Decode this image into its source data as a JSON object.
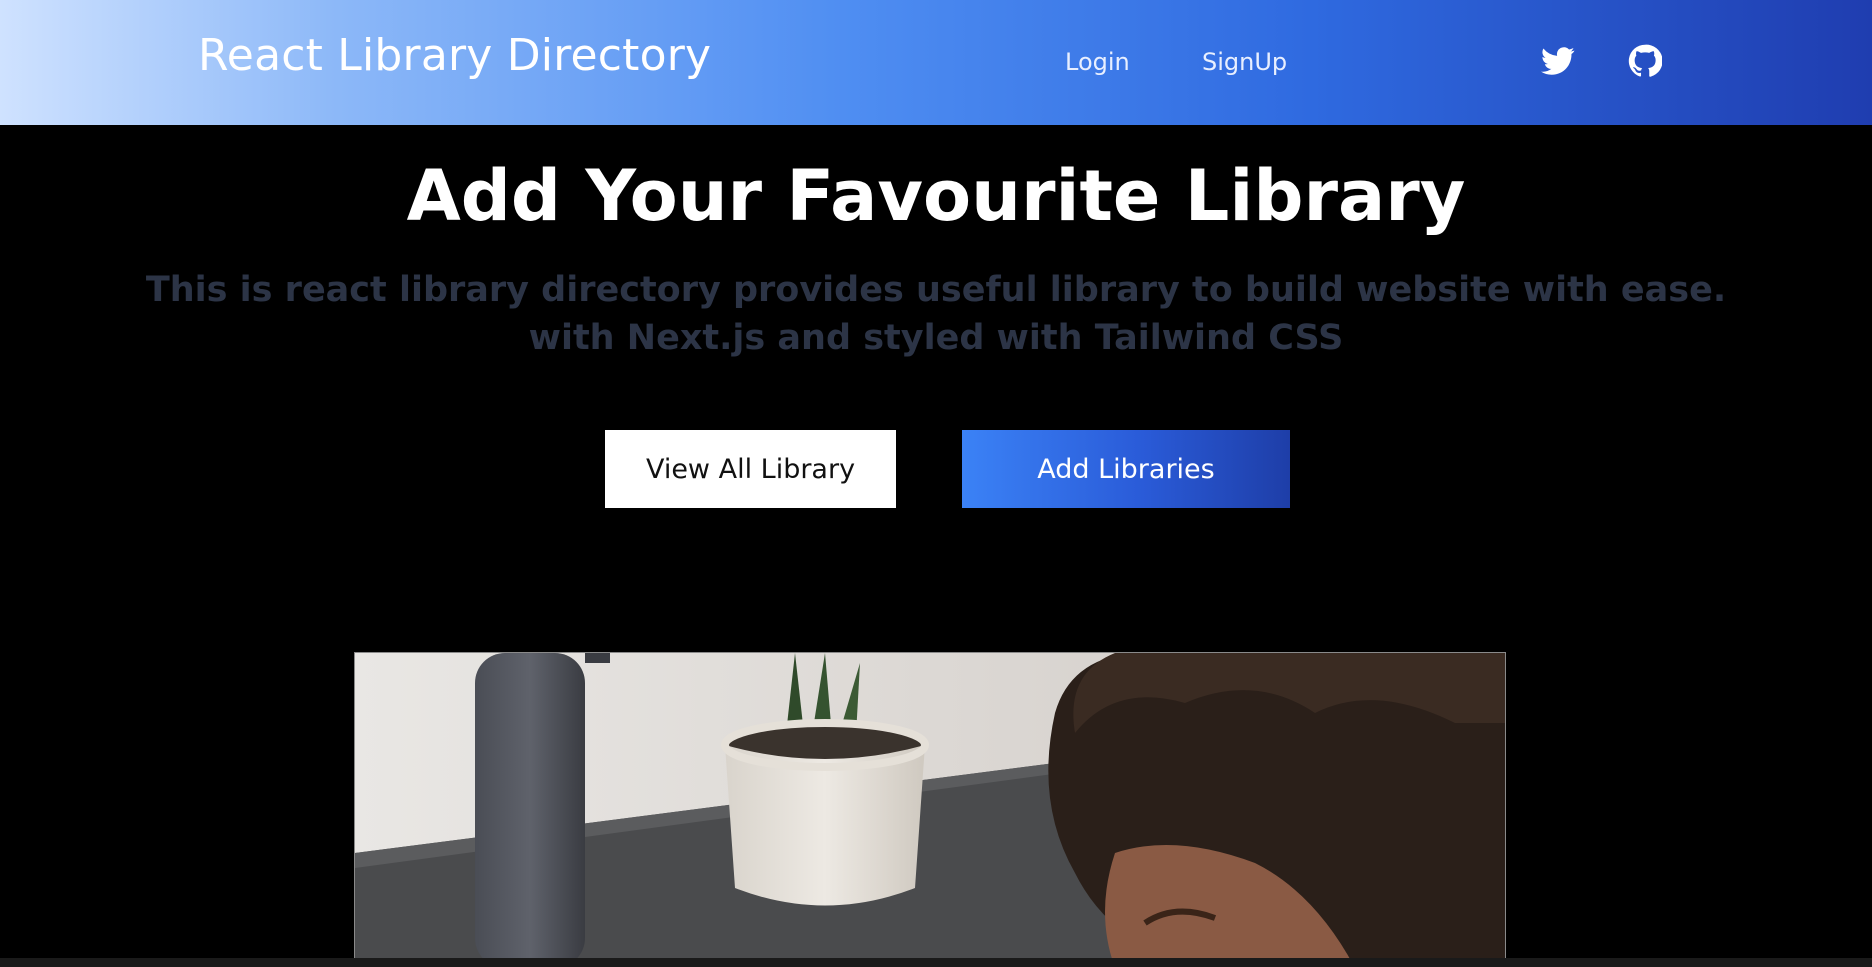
{
  "header": {
    "brand": "React Library Directory",
    "nav": {
      "login": "Login",
      "signup": "SignUp"
    },
    "icons": [
      "twitter-icon",
      "github-icon"
    ]
  },
  "hero": {
    "title": "Add Your Favourite Library",
    "subtitle_line1": "This is react library directory provides useful library to build website with ease.",
    "subtitle_line2": "with Next.js and styled with Tailwind CSS",
    "buttons": {
      "view_all": "View All Library",
      "add": "Add Libraries"
    }
  },
  "colors": {
    "accent": "#2f6ae0",
    "subtitle": "#2c3446",
    "background": "#000000"
  }
}
